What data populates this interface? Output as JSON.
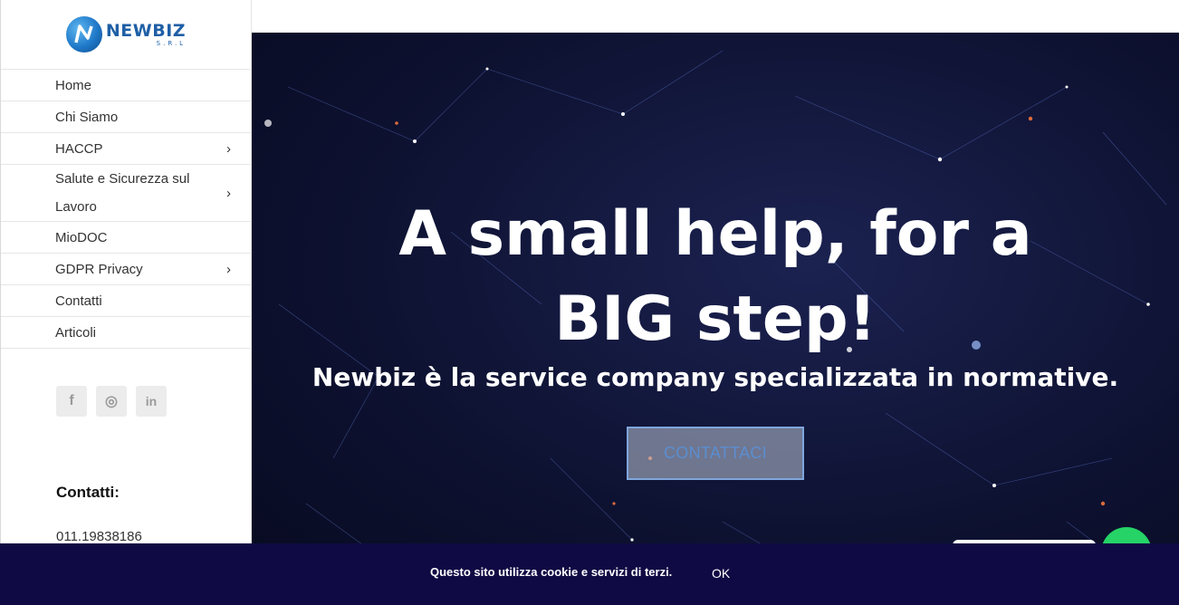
{
  "brand": {
    "name": "NEWBIZ",
    "sub": "S.R.L"
  },
  "menu": [
    {
      "label": "Home",
      "submenu": false
    },
    {
      "label": "Chi Siamo",
      "submenu": false
    },
    {
      "label": "HACCP",
      "submenu": true
    },
    {
      "label": "Salute e Sicurezza sul Lavoro",
      "submenu": true
    },
    {
      "label": "MioDOC",
      "submenu": false
    },
    {
      "label": "GDPR Privacy",
      "submenu": true
    },
    {
      "label": "Contatti",
      "submenu": false
    },
    {
      "label": "Articoli",
      "submenu": false
    }
  ],
  "social": {
    "facebook": "f",
    "instagram": "◎",
    "linkedin": "in"
  },
  "contacts": {
    "title": "Contatti:",
    "phone": "011.19838186"
  },
  "hero": {
    "title": "A small help, for a BIG step!",
    "subtitle": "Newbiz è la service company specializzata in normative.",
    "button": "CONTATTACI"
  },
  "cookie": {
    "text": "Questo sito utilizza cookie e servizi di terzi.",
    "ok": "OK"
  },
  "icons": [
    "facebook-icon",
    "instagram-icon",
    "linkedin-icon",
    "chevron-right-icon",
    "whatsapp-icon"
  ],
  "colors": {
    "cookie_bg": "#100a44",
    "brand_blue": "#1f5fa6",
    "button_text": "#5b8ed0",
    "whatsapp": "#25d366"
  }
}
